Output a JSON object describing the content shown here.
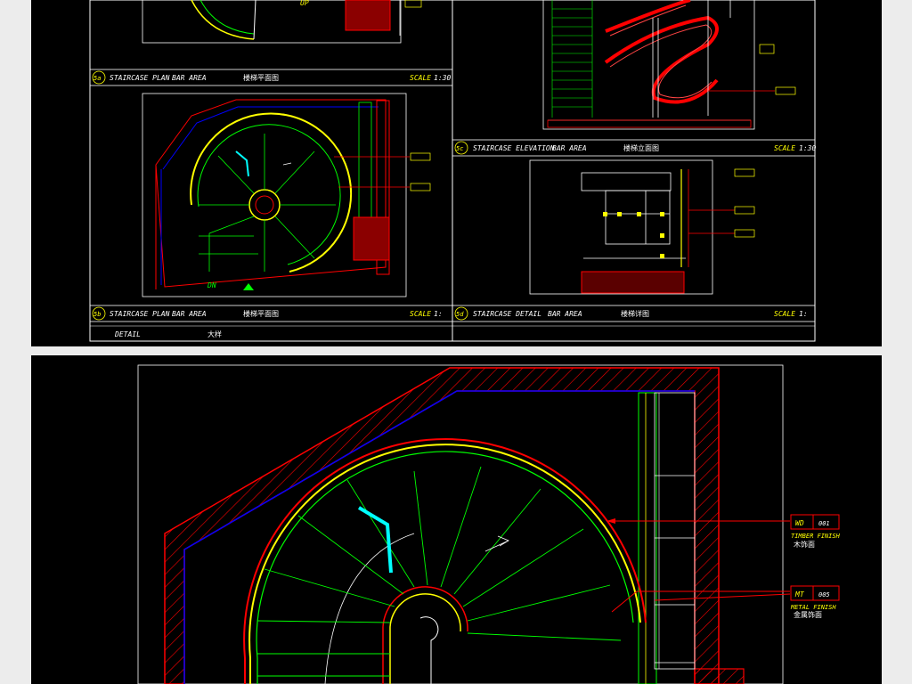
{
  "panels": [
    {
      "id": "5a",
      "code": "5a",
      "title": "STAIRCASE PLAN",
      "area": "BAR AREA",
      "cn_title": "楼梯平面图",
      "scale_label": "SCALE",
      "scale_value": "1:30"
    },
    {
      "id": "5b",
      "code": "5b",
      "title": "STAIRCASE PLAN",
      "area": "BAR AREA",
      "cn_title": "楼梯平面图",
      "scale_label": "SCALE",
      "scale_value": "1:"
    },
    {
      "id": "5c",
      "code": "5c",
      "title": "STAIRCASE ELEVATION",
      "area": "BAR AREA",
      "cn_title": "楼梯立面图",
      "scale_label": "SCALE",
      "scale_value": "1:30"
    },
    {
      "id": "5d",
      "code": "5d",
      "title": "STAIRCASE DETAIL",
      "area": "BAR AREA",
      "cn_title": "楼梯详图",
      "scale_label": "SCALE",
      "scale_value": "1:"
    }
  ],
  "detail_row": {
    "label": "DETAIL",
    "cn_label": "大样"
  },
  "plan_marks": {
    "up": "UP",
    "dn": "DN"
  },
  "finish_tags": [
    {
      "code": "WD",
      "number": "001",
      "en": "TIMBER FINISH",
      "cn": "木饰面"
    },
    {
      "code": "MT",
      "number": "005",
      "en": "METAL FINISH",
      "cn": "金属饰面"
    }
  ],
  "colors": {
    "background": "#000000",
    "frame": "#ffffff",
    "wall_hatch": "#ff0000",
    "outline": "#0000ff",
    "stair_rail": "#ffff00",
    "stair_tread": "#00ff00",
    "annotation": "#ffff00",
    "highlight": "#00ffff"
  }
}
